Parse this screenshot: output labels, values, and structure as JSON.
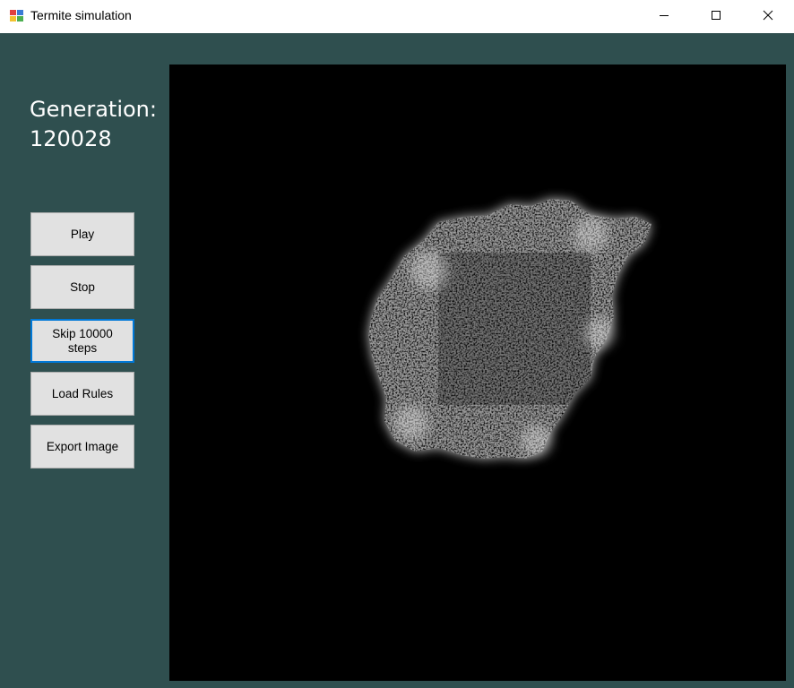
{
  "window": {
    "title": "Termite simulation",
    "icon": "app-icon",
    "controls": [
      "minimize-icon",
      "maximize-icon",
      "close-icon"
    ]
  },
  "generation": {
    "label": "Generation:",
    "value": "120028"
  },
  "buttons": {
    "play": "Play",
    "stop": "Stop",
    "skip": "Skip 10000 steps",
    "load_rules": "Load Rules",
    "export_image": "Export Image"
  },
  "colors": {
    "background": "#2f4f4f",
    "canvas": "#000000",
    "button": "#e1e1e1",
    "focus": "#0078d7"
  }
}
